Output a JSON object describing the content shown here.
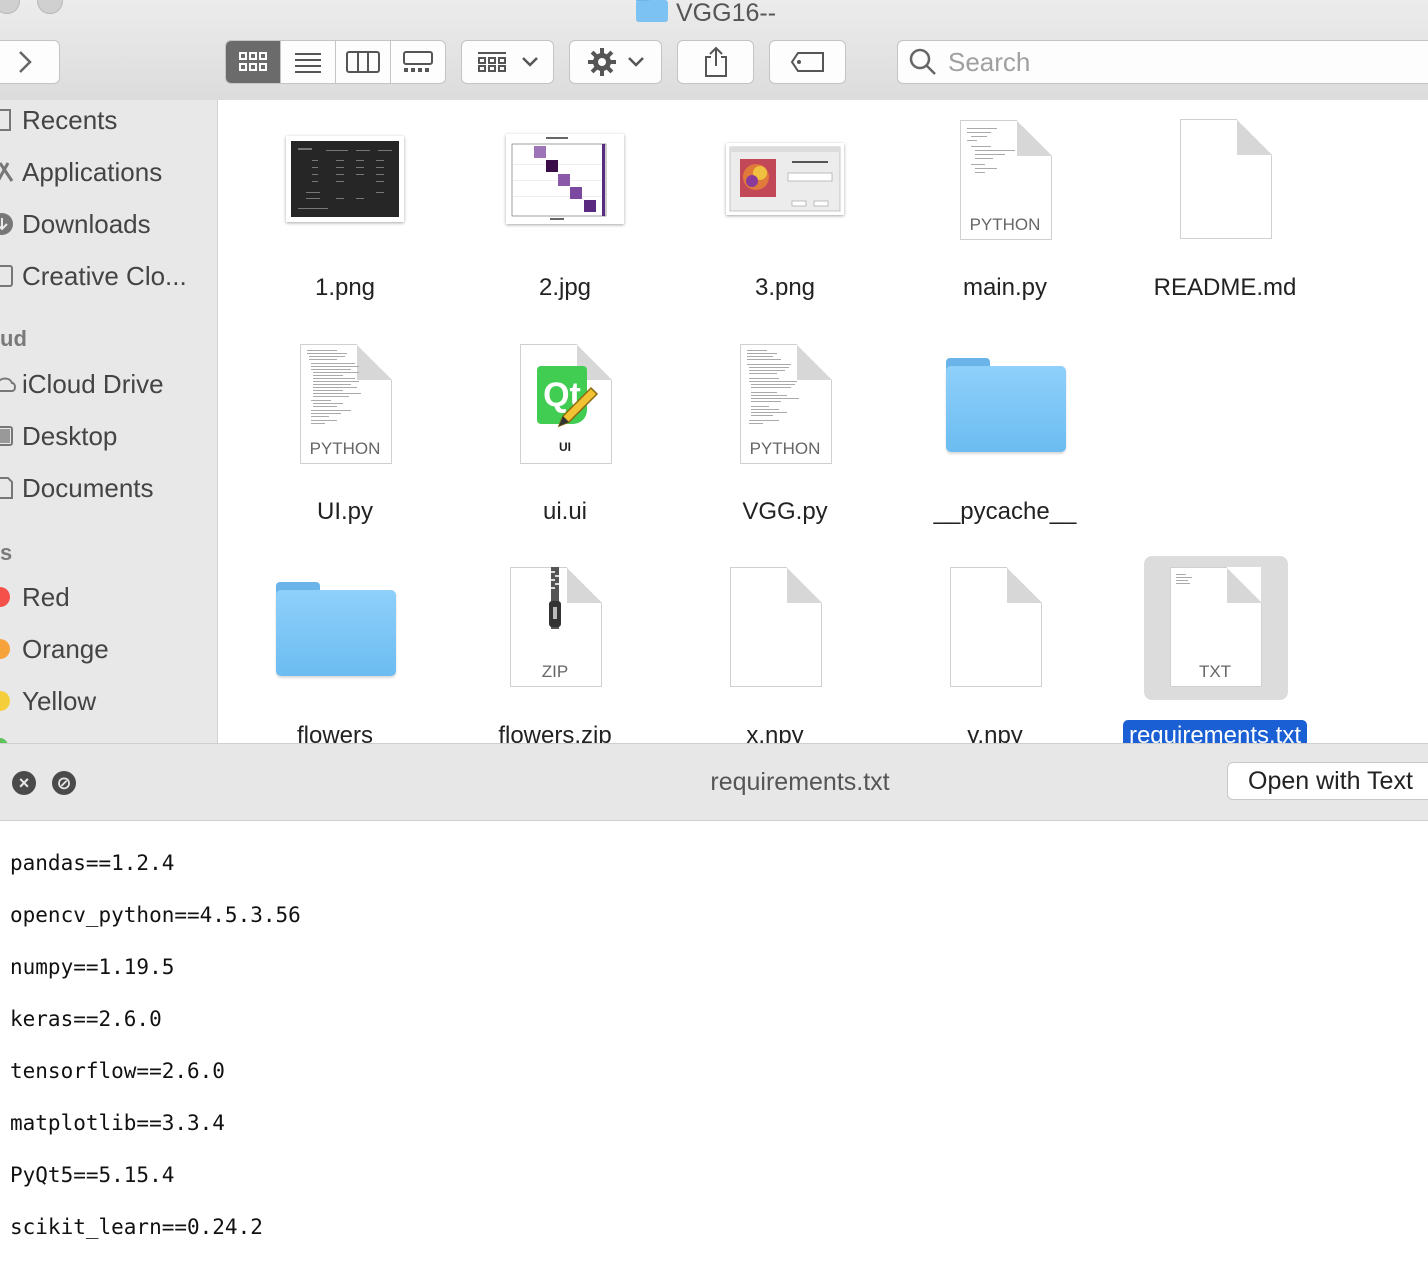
{
  "window": {
    "title": "VGG16--"
  },
  "toolbar": {
    "search_placeholder": "Search"
  },
  "sidebar": {
    "favorites": [
      {
        "label": "Recents",
        "icon": "recents-icon"
      },
      {
        "label": "Applications",
        "icon": "applications-icon"
      },
      {
        "label": "Downloads",
        "icon": "downloads-icon"
      },
      {
        "label": "Creative Clo...",
        "icon": "creative-cloud-icon"
      }
    ],
    "icloud_heading": "ud",
    "icloud": [
      {
        "label": "iCloud Drive",
        "icon": "icloud-icon"
      },
      {
        "label": "Desktop",
        "icon": "desktop-icon"
      },
      {
        "label": "Documents",
        "icon": "documents-icon"
      }
    ],
    "tags_heading": "s",
    "tags": [
      {
        "label": "Red",
        "color": "#f5504a"
      },
      {
        "label": "Orange",
        "color": "#f5a33a"
      },
      {
        "label": "Yellow",
        "color": "#f5cf3b"
      }
    ]
  },
  "files": [
    {
      "name": "1.png",
      "kind": "image"
    },
    {
      "name": "2.jpg",
      "kind": "image"
    },
    {
      "name": "3.png",
      "kind": "image"
    },
    {
      "name": "main.py",
      "kind": "python",
      "badge": "PYTHON"
    },
    {
      "name": "README.md",
      "kind": "blank"
    },
    {
      "name": "UI.py",
      "kind": "python",
      "badge": "PYTHON"
    },
    {
      "name": "ui.ui",
      "kind": "qt",
      "badge": "UI",
      "logo": "Qt"
    },
    {
      "name": "VGG.py",
      "kind": "python",
      "badge": "PYTHON"
    },
    {
      "name": "__pycache__",
      "kind": "folder"
    },
    {
      "name": "flowers",
      "kind": "folder"
    },
    {
      "name": "flowers.zip",
      "kind": "zip",
      "badge": "ZIP"
    },
    {
      "name": "x.npy",
      "kind": "blank"
    },
    {
      "name": "y.npy",
      "kind": "blank"
    },
    {
      "name": "requirements.txt",
      "kind": "txt",
      "badge": "TXT",
      "selected": true
    }
  ],
  "quicklook": {
    "title": "requirements.txt",
    "open_button": "Open with Text",
    "content": [
      "pandas==1.2.4",
      "opencv_python==4.5.3.56",
      "numpy==1.19.5",
      "keras==2.6.0",
      "tensorflow==2.6.0",
      "matplotlib==3.3.4",
      "PyQt5==5.15.4",
      "scikit_learn==0.24.2"
    ]
  }
}
